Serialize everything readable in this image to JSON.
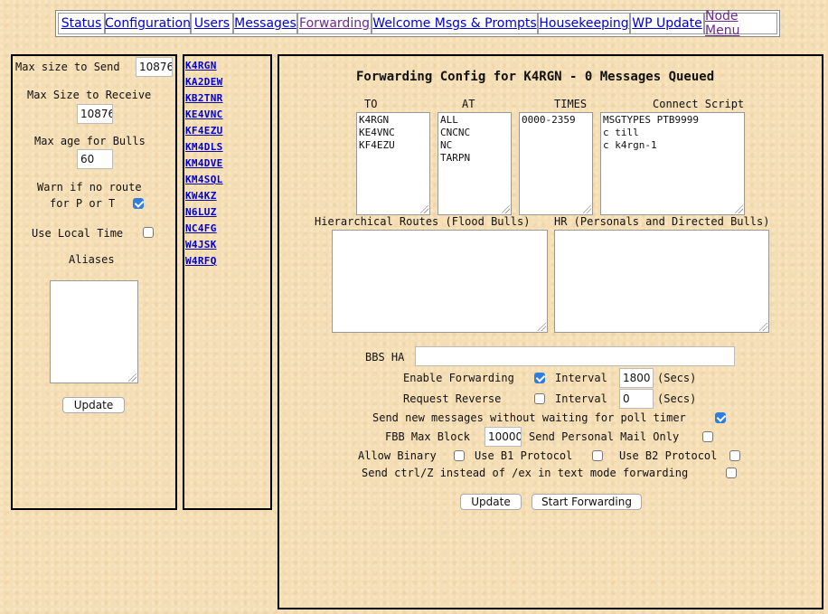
{
  "nav": {
    "items": [
      {
        "label": "Status"
      },
      {
        "label": "Configuration"
      },
      {
        "label": "Users"
      },
      {
        "label": "Messages"
      },
      {
        "label": "Forwarding"
      },
      {
        "label": "Welcome Msgs & Prompts"
      },
      {
        "label": "Housekeeping"
      },
      {
        "label": "WP Update"
      },
      {
        "label": "Node Menu"
      }
    ]
  },
  "left": {
    "max_send_label": "Max size to Send",
    "max_send_value": "10876",
    "max_recv_label": "Max Size to Receive",
    "max_recv_value": "10876",
    "max_age_label": "Max age for Bulls",
    "max_age_value": "60",
    "warn_line1": "Warn if no route",
    "warn_line2": "for P or T",
    "warn_checked": true,
    "local_time_label": "Use Local Time",
    "local_time_checked": false,
    "aliases_label": "Aliases",
    "aliases_value": "",
    "update_label": "Update"
  },
  "calls": [
    "K4RGN",
    "KA2DEW",
    "KB2TNR",
    "KE4VNC",
    "KF4EZU",
    "KM4DLS",
    "KM4DVE",
    "KM4SQL",
    "KW4KZ",
    "N6LUZ",
    "NC4FG",
    "W4JSK",
    "W4RFQ"
  ],
  "main": {
    "title": "Forwarding Config for K4RGN - 0 Messages Queued",
    "to_header": "TO",
    "at_header": "AT",
    "times_header": "TIMES",
    "script_header": "Connect Script",
    "to_lines": [
      "K4RGN",
      "KE4VNC",
      "KF4EZU"
    ],
    "at_lines": [
      "ALL",
      "CNCNC",
      "NC",
      "TARPN"
    ],
    "times_lines": [
      "0000-2359"
    ],
    "script_lines": [
      "MSGTYPES PTB9999",
      "c till",
      "c k4rgn-1"
    ],
    "hr_flood_label": "Hierarchical Routes (Flood Bulls)",
    "hr_personal_label": "HR (Personals and Directed Bulls)",
    "bbs_ha_label": "BBS HA",
    "bbs_ha_value": "",
    "enable_fwd_label": "Enable Forwarding",
    "enable_fwd_checked": true,
    "interval_label": "Interval",
    "interval1_value": "1800",
    "secs_label": "(Secs)",
    "request_reverse_label": "Request Reverse",
    "request_reverse_checked": false,
    "interval2_value": "0",
    "send_new_label": "Send new messages without waiting for poll timer",
    "send_new_checked": true,
    "fbb_label": "FBB Max Block",
    "fbb_value": "10000",
    "personal_only_label": "Send Personal Mail Only",
    "personal_only_checked": false,
    "allow_binary_label": "Allow Binary",
    "allow_binary_checked": false,
    "b1_label": "Use B1 Protocol",
    "b1_checked": false,
    "b2_label": "Use B2 Protocol",
    "b2_checked": false,
    "ctrlz_label": "Send ctrl/Z instead of /ex in text mode forwarding",
    "ctrlz_checked": false,
    "update_label": "Update",
    "start_fwd_label": "Start Forwarding"
  },
  "colors": {
    "background": "#f5deb3",
    "link": "#0000cc",
    "visited": "#6a2a8a",
    "check": "#2f7de1"
  }
}
